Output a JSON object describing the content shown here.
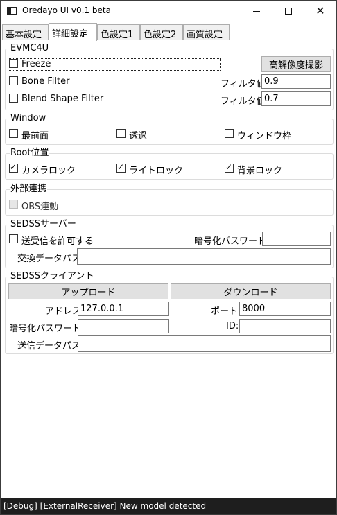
{
  "window": {
    "title": "Oredayo UI v0.1 beta"
  },
  "tabs": [
    {
      "label": "基本設定",
      "active": false
    },
    {
      "label": "詳細設定",
      "active": true
    },
    {
      "label": "色設定1",
      "active": false
    },
    {
      "label": "色設定2",
      "active": false
    },
    {
      "label": "画質設定",
      "active": false
    }
  ],
  "evmc4u": {
    "title": "EVMC4U",
    "freeze_label": "Freeze",
    "freeze_checked": false,
    "capture_button": "高解像度撮影",
    "bone_filter_label": "Bone Filter",
    "bone_filter_checked": false,
    "bone_filter_value_label": "フィルタ値:",
    "bone_filter_value": "0.9",
    "blend_shape_label": "Blend Shape Filter",
    "blend_shape_checked": false,
    "blend_shape_value_label": "フィルタ値:",
    "blend_shape_value": "0.7"
  },
  "window_group": {
    "title": "Window",
    "topmost_label": "最前面",
    "topmost_checked": false,
    "transparent_label": "透過",
    "transparent_checked": false,
    "frame_label": "ウィンドウ枠",
    "frame_checked": false
  },
  "root": {
    "title": "Root位置",
    "camera_lock_label": "カメラロック",
    "camera_lock_checked": true,
    "light_lock_label": "ライトロック",
    "light_lock_checked": true,
    "bg_lock_label": "背景ロック",
    "bg_lock_checked": true
  },
  "external": {
    "title": "外部連携",
    "obs_label": "OBS連動",
    "obs_checked": false
  },
  "sedss_server": {
    "title": "SEDSSサーバー",
    "allow_label": "送受信を許可する",
    "allow_checked": false,
    "password_label": "暗号化パスワード:",
    "password_value": "",
    "exchange_path_label": "交換データパス:",
    "exchange_path_value": ""
  },
  "sedss_client": {
    "title": "SEDSSクライアント",
    "upload_button": "アップロード",
    "download_button": "ダウンロード",
    "address_label": "アドレス:",
    "address_value": "127.0.0.1",
    "port_label": "ポート:",
    "port_value": "8000",
    "password_label": "暗号化パスワード:",
    "password_value": "",
    "id_label": "ID:",
    "id_value": "",
    "send_path_label": "送信データパス:",
    "send_path_value": ""
  },
  "status": {
    "message": "[Debug] [ExternalReceiver] New model detected"
  },
  "colors": {
    "status_bg": "#1e1e1e",
    "button_bg": "#e1e1e1",
    "tab_bg": "#f0f0f0"
  }
}
